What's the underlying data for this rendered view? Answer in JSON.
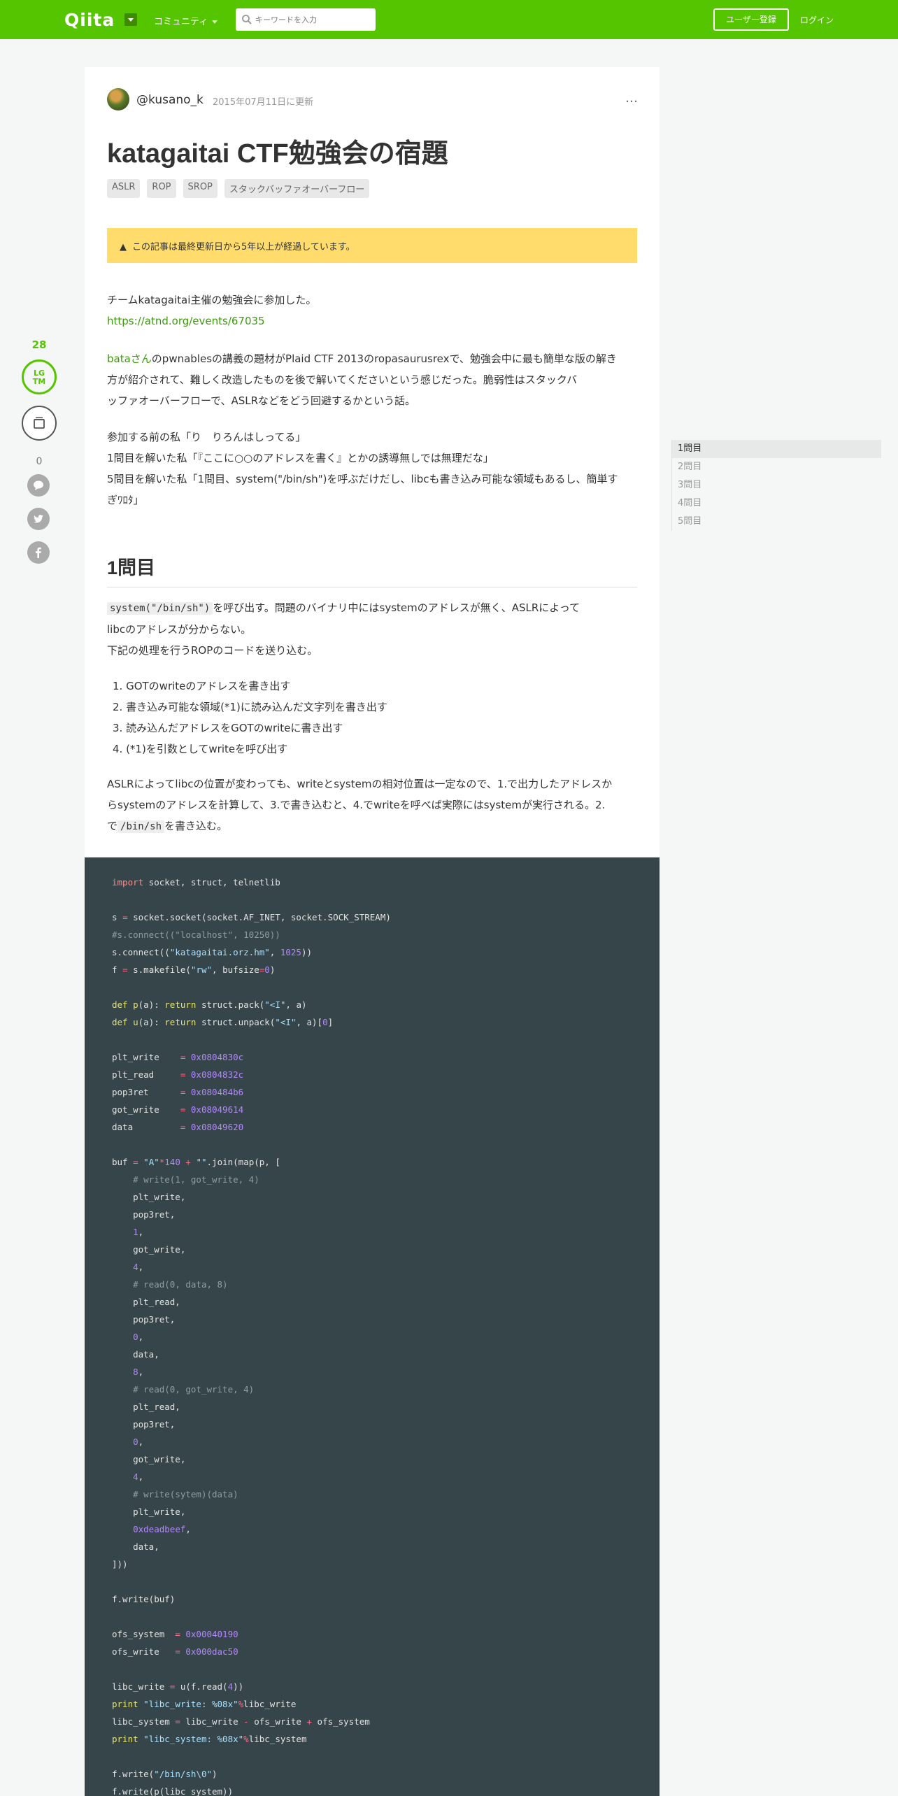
{
  "header": {
    "logo": "Qiita",
    "community_label": "コミュニティ",
    "search_placeholder": "キーワードを入力",
    "signup_label": "ユーザー登録",
    "login_label": "ログイン"
  },
  "article": {
    "author": "@kusano_k",
    "updated": "2015年07月11日に更新",
    "more_icon": "…",
    "title": "katagaitai CTF勉強会の宿題",
    "tags": [
      "ASLR",
      "ROP",
      "SROP",
      "スタックバッファオーバーフロー"
    ],
    "warning": "この記事は最終更新日から5年以上が経過しています。",
    "intro_line1": "チームkatagaitai主催の勉強会に参加した。",
    "intro_link": "https://atnd.org/events/67035",
    "para2_link": "bataさん",
    "para2_line1": "のpwnablesの講義の題材がPlaid CTF 2013のropasaurusrexで、勉強会中に最も簡単な版の解き",
    "para2_line2": "方が紹介されて、難しく改造したものを後で解いてくださいという感じだった。脆弱性はスタックバ",
    "para2_line3": "ッファオーバーフローで、ASLRなどをどう回避するかという話。",
    "para3_line1": "参加する前の私「り　りろんはしってる」",
    "para3_line2": "1問目を解いた私「『ここに○○のアドレスを書く』とかの誘導無しでは無理だな」",
    "para3_line3": "5問目を解いた私「1問目、system(\"/bin/sh\")を呼ぶだけだし、libcも書き込み可能な領域もあるし、簡単す",
    "para3_line4": "ぎﾜﾛﾀ」",
    "h2": "1問目",
    "p4_code": "system(\"/bin/sh\")",
    "p4_rest": "を呼び出す。問題のバイナリ中にはsystemのアドレスが無く、ASLRによって",
    "p4_line2": "libcのアドレスが分からない。",
    "p4_line3": "下記の処理を行うROPのコードを送り込む。",
    "list": [
      "1. GOTのwriteのアドレスを書き出す",
      "2. 書き込み可能な領域(*1)に読み込んだ文字列を書き出す",
      "3. 読み込んだアドレスをGOTのwriteに書き出す",
      "4. (*1)を引数としてwriteを呼び出す"
    ],
    "p5_line1": "ASLRによってlibcの位置が変わっても、writeとsystemの相対位置は一定なので、1.で出力したアドレスか",
    "p5_line2": "らsystemのアドレスを計算して、3.で書き込むと、4.でwriteを呼べば実際にはsystemが実行される。2.",
    "p5_pre": "で",
    "p5_code": "/bin/sh",
    "p5_post": "を書き込む。"
  },
  "sidebar": {
    "lgtm_count": "28",
    "lgtm_label_1": "LG",
    "lgtm_label_2": "TM",
    "stock_count": "0"
  },
  "toc": [
    "1問目",
    "2問目",
    "3問目",
    "4問目",
    "5問目"
  ]
}
